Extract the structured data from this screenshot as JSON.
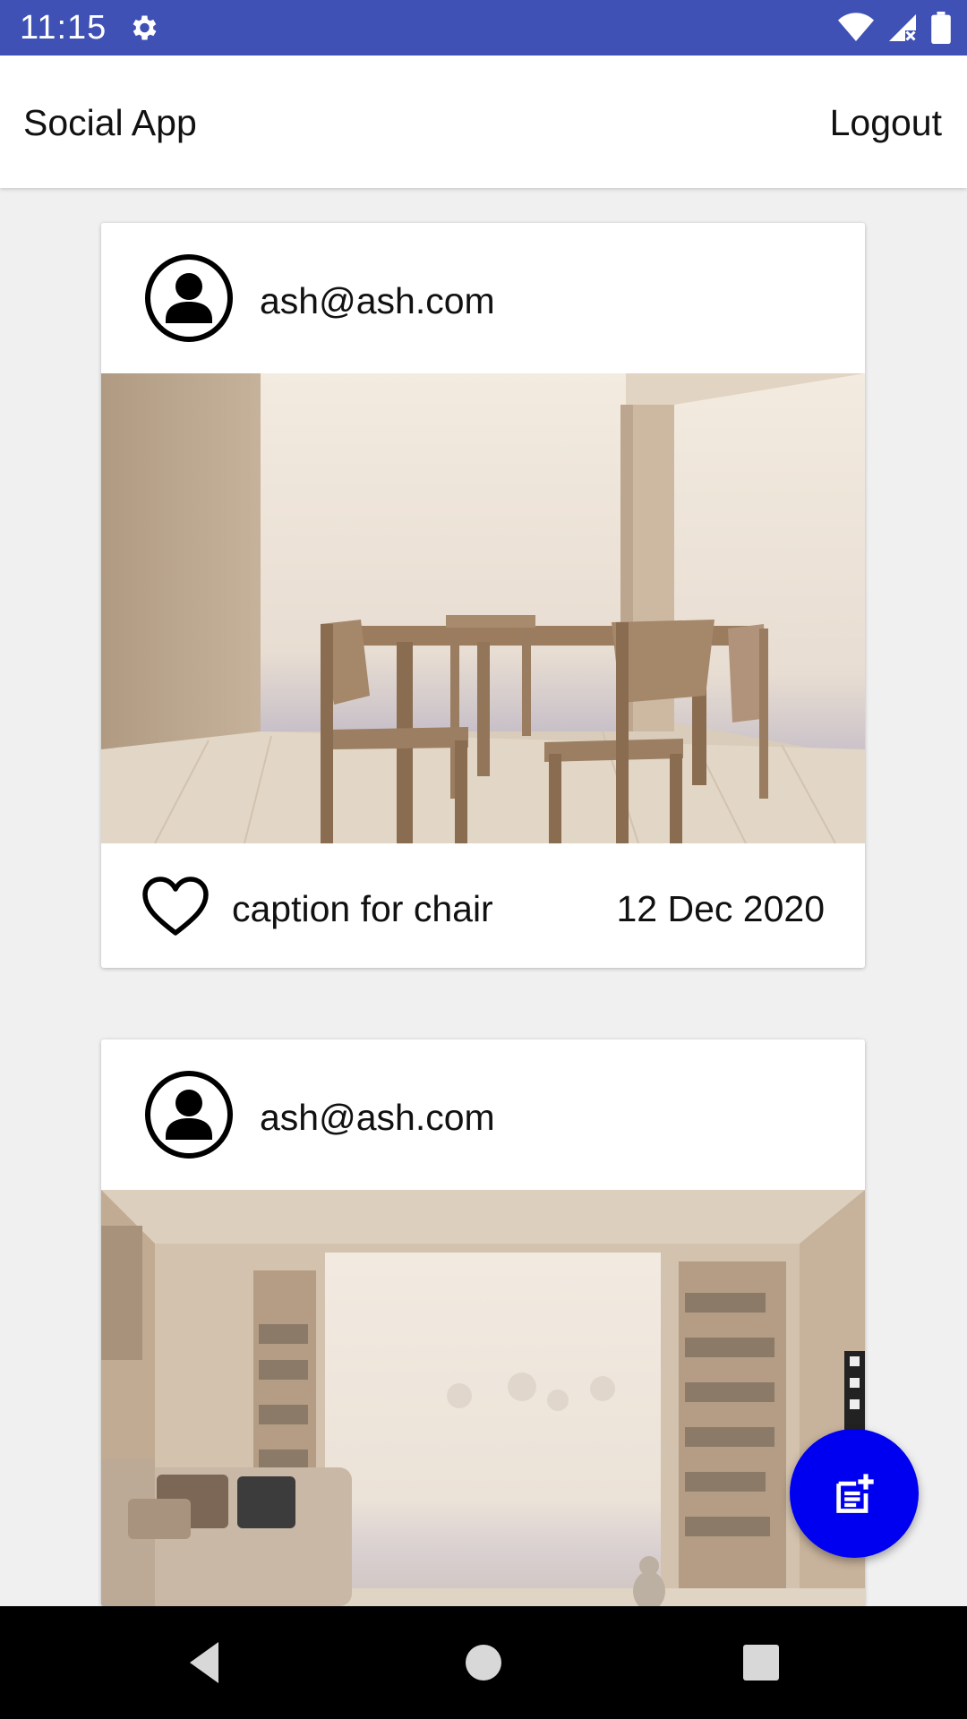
{
  "status_bar": {
    "time": "11:15",
    "icons": [
      "settings-gear-icon",
      "wifi-icon",
      "cell-signal-icon",
      "battery-icon"
    ],
    "background": "#3f51b5"
  },
  "app_bar": {
    "title": "Social App",
    "logout_label": "Logout"
  },
  "posts": [
    {
      "user_email": "ash@ash.com",
      "avatar_icon": "account-circle-icon",
      "image_description": "dining-room-photo",
      "like_icon": "heart-outline-icon",
      "caption": "caption for chair",
      "date": "12 Dec 2020"
    },
    {
      "user_email": "ash@ash.com",
      "avatar_icon": "account-circle-icon",
      "image_description": "living-room-photo"
    }
  ],
  "fab": {
    "icon": "new-post-icon",
    "color": "#0000f0"
  },
  "nav_bar": {
    "buttons": [
      "back-icon",
      "home-icon",
      "recents-icon"
    ]
  }
}
